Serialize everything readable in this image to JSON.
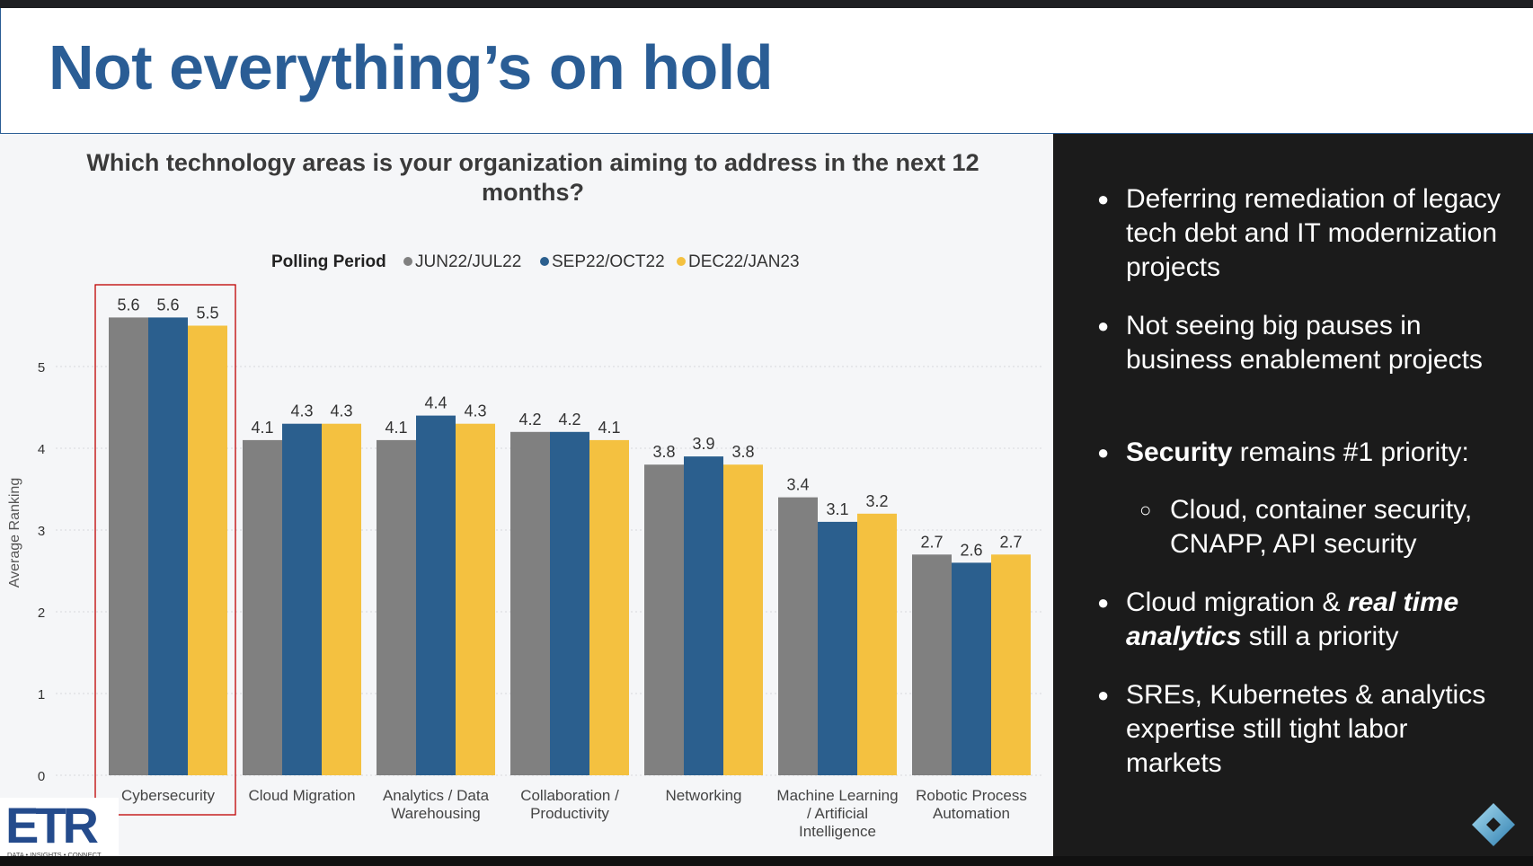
{
  "slide": {
    "title": "Not everything’s on hold"
  },
  "chart_data": {
    "type": "bar",
    "title": "Which technology areas is your organization aiming to address in the next 12 months?",
    "title_lines": [
      "Which technology areas is your organization aiming to address in the next 12",
      "months?"
    ],
    "legend_title": "Polling Period",
    "legend_placement": "top",
    "ylabel": "Average Ranking",
    "xlabel": "",
    "ylim": [
      0,
      6
    ],
    "yticks": [
      0,
      1,
      2,
      3,
      4,
      5
    ],
    "grid": true,
    "categories": [
      "Cybersecurity",
      "Cloud Migration",
      "Analytics / Data Warehousing",
      "Collaboration / Productivity",
      "Networking",
      "Machine Learning / Artificial Intelligence",
      "Robotic Process Automation"
    ],
    "category_lines": [
      [
        "Cybersecurity"
      ],
      [
        "Cloud Migration"
      ],
      [
        "Analytics / Data",
        "Warehousing"
      ],
      [
        "Collaboration /",
        "Productivity"
      ],
      [
        "Networking"
      ],
      [
        "Machine Learning",
        "/ Artificial",
        "Intelligence"
      ],
      [
        "Robotic Process",
        "Automation"
      ]
    ],
    "series": [
      {
        "name": "JUN22/JUL22",
        "color": "#808080",
        "values": [
          5.6,
          4.1,
          4.1,
          4.2,
          3.8,
          3.4,
          2.7
        ]
      },
      {
        "name": "SEP22/OCT22",
        "color": "#2b5f8e",
        "values": [
          5.6,
          4.3,
          4.4,
          4.2,
          3.9,
          3.1,
          2.6
        ]
      },
      {
        "name": "DEC22/JAN23",
        "color": "#f4c140",
        "values": [
          5.5,
          4.3,
          4.3,
          4.1,
          3.8,
          3.2,
          2.7
        ]
      }
    ],
    "highlight": {
      "category": "Cybersecurity",
      "color": "#c00000"
    }
  },
  "bullets": {
    "b1": "Deferring remediation of legacy tech debt and IT modernization projects",
    "b2": "Not seeing big pauses in business enablement projects",
    "b3_bold": "Security",
    "b3_rest": " remains #1 priority:",
    "b4": "Cloud, container security, CNAPP, API security",
    "b5_pre": "Cloud migration & ",
    "b5_em": "real time analytics",
    "b5_post": " still a priority",
    "b6": "SREs, Kubernetes & analytics expertise still tight labor markets",
    "bullet_glyph": "●",
    "sub_glyph": "○"
  },
  "logo": {
    "name": "ETR",
    "tagline": "DATA • INSIGHTS • CONNECT",
    "color": "#244b8c"
  },
  "icons": {
    "corner": "blue-diamond-logo-icon"
  },
  "colors": {
    "title": "#2a5d95",
    "right_panel": "#1b1b1b",
    "chart_bg": "#f5f6f8"
  }
}
